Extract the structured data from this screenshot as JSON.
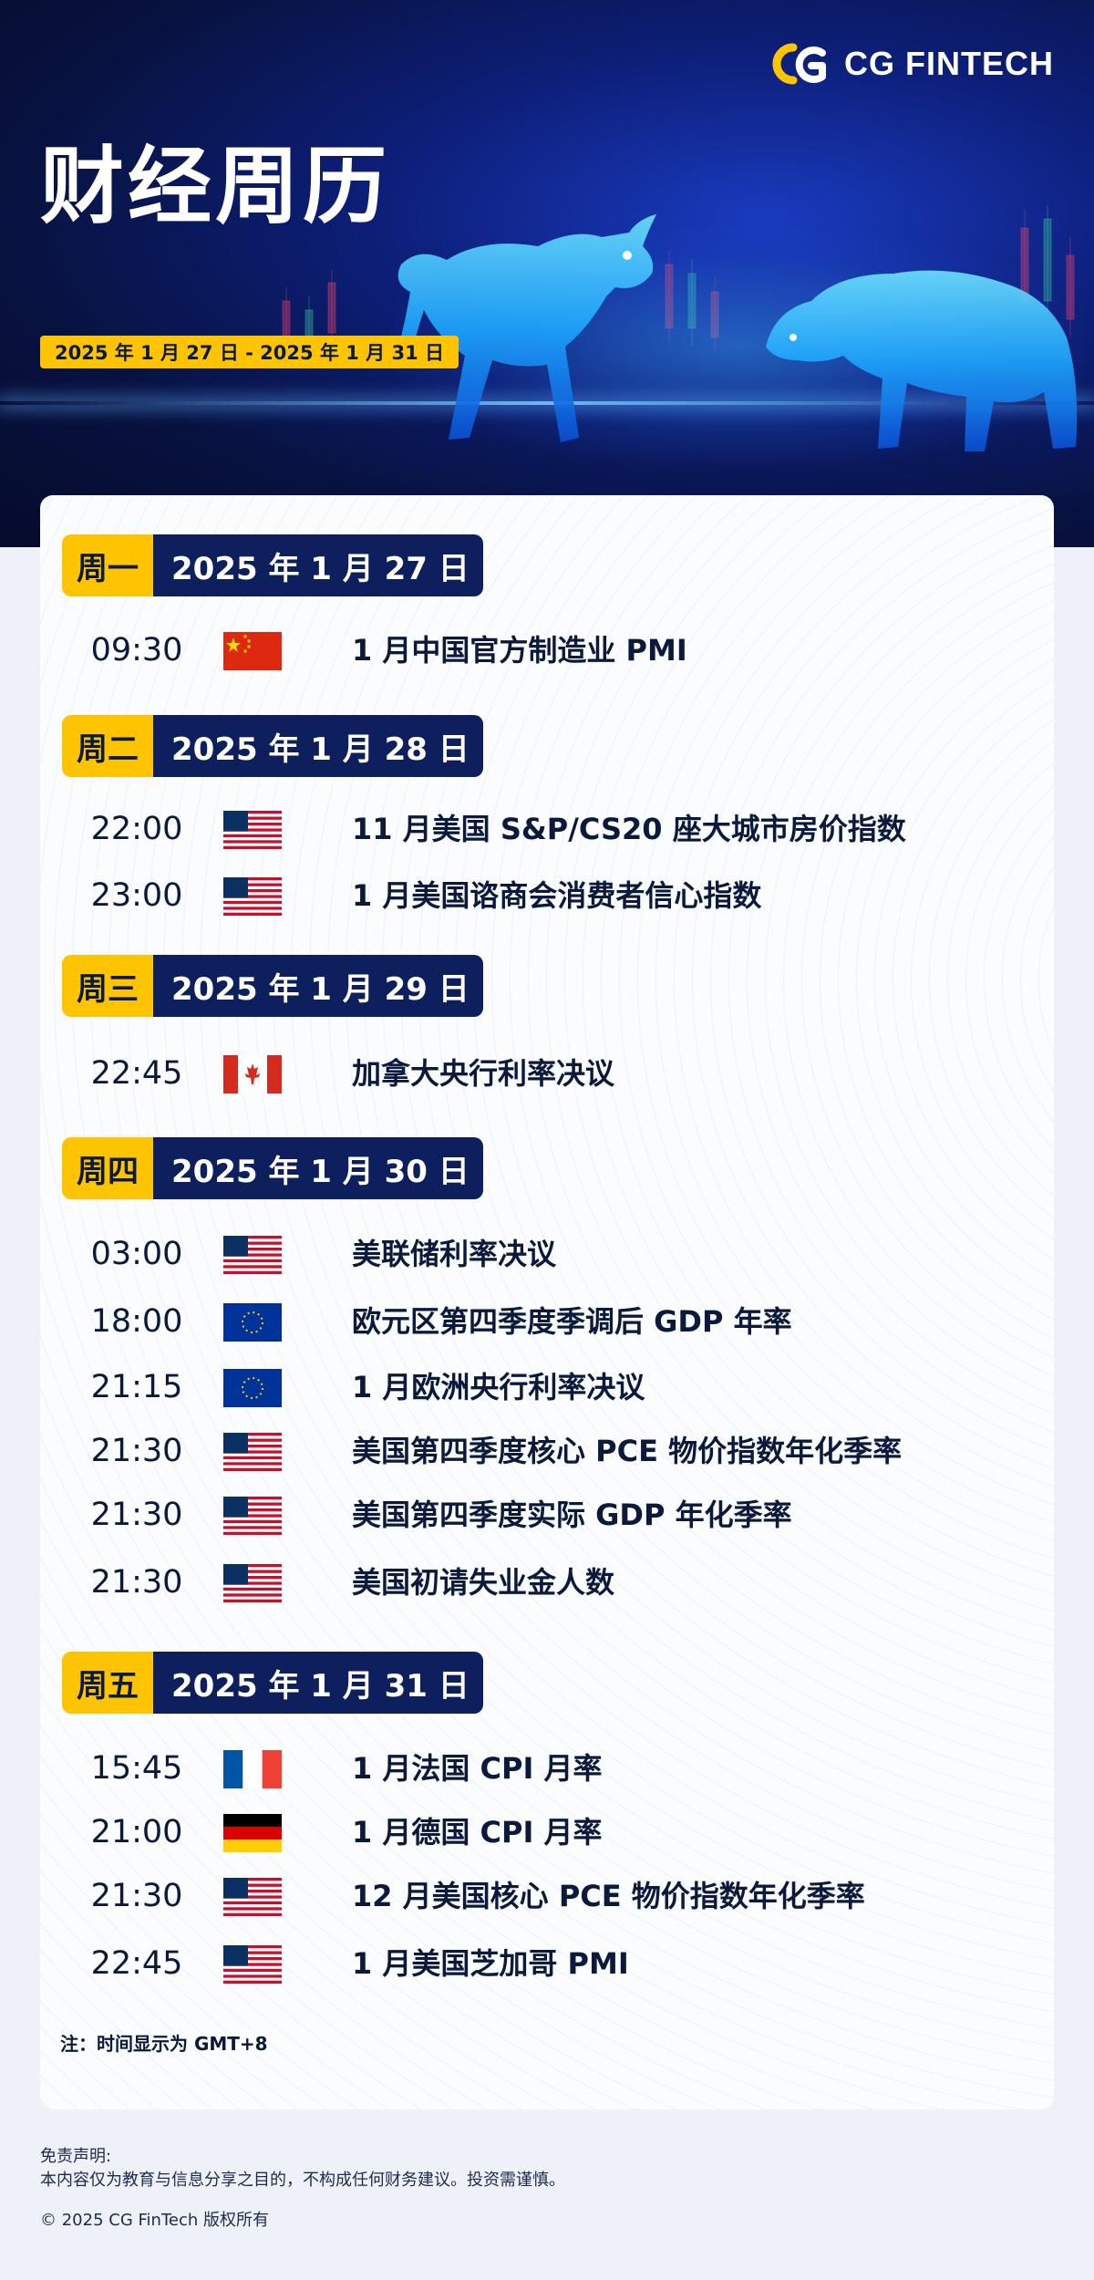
{
  "brand": {
    "logo_text": "CG FINTECH"
  },
  "hero": {
    "title": "财经周历",
    "date_range": "2025 年 1 月 27 日 - 2025 年 1 月 31 日"
  },
  "days": [
    {
      "day": "周一",
      "date": "2025 年 1 月 27 日",
      "events": [
        {
          "time": "09:30",
          "flag": "china-flag-icon",
          "title": "1 月中国官方制造业 PMI"
        }
      ]
    },
    {
      "day": "周二",
      "date": "2025 年 1 月 28 日",
      "events": [
        {
          "time": "22:00",
          "flag": "usa-flag-icon",
          "title": "11 月美国 S&P/CS20 座大城市房价指数"
        },
        {
          "time": "23:00",
          "flag": "usa-flag-icon",
          "title": "1 月美国谘商会消费者信心指数"
        }
      ]
    },
    {
      "day": "周三",
      "date": "2025 年 1 月 29 日",
      "events": [
        {
          "time": "22:45",
          "flag": "canada-flag-icon",
          "title": "加拿大央行利率决议"
        }
      ]
    },
    {
      "day": "周四",
      "date": "2025 年 1 月 30 日",
      "events": [
        {
          "time": "03:00",
          "flag": "usa-flag-icon",
          "title": "美联储利率决议"
        },
        {
          "time": "18:00",
          "flag": "eu-flag-icon",
          "title": "欧元区第四季度季调后 GDP 年率"
        },
        {
          "time": "21:15",
          "flag": "eu-flag-icon",
          "title": "1 月欧洲央行利率决议"
        },
        {
          "time": "21:30",
          "flag": "usa-flag-icon",
          "title": "美国第四季度核心 PCE 物价指数年化季率"
        },
        {
          "time": "21:30",
          "flag": "usa-flag-icon",
          "title": "美国第四季度实际 GDP 年化季率"
        },
        {
          "time": "21:30",
          "flag": "usa-flag-icon",
          "title": "美国初请失业金人数"
        }
      ]
    },
    {
      "day": "周五",
      "date": "2025 年 1 月 31 日",
      "events": [
        {
          "time": "15:45",
          "flag": "france-flag-icon",
          "title": "1 月法国 CPI 月率"
        },
        {
          "time": "21:00",
          "flag": "germany-flag-icon",
          "title": "1 月德国 CPI 月率"
        },
        {
          "time": "21:30",
          "flag": "usa-flag-icon",
          "title": "12 月美国核心 PCE 物价指数年化季率"
        },
        {
          "time": "22:45",
          "flag": "usa-flag-icon",
          "title": "1 月美国芝加哥 PMI"
        }
      ]
    }
  ],
  "note": "注：时间显示为 GMT+8",
  "footer": {
    "disclaimer_title": "免责声明:",
    "disclaimer_text": "本内容仅为教育与信息分享之目的，不构成任何财务建议。投资需谨慎。",
    "copyright": "© 2025 CG FinTech 版权所有"
  },
  "colors": {
    "accent": "#ffc400",
    "navy": "#0d1f5c",
    "hero_bg": "#08123f"
  }
}
